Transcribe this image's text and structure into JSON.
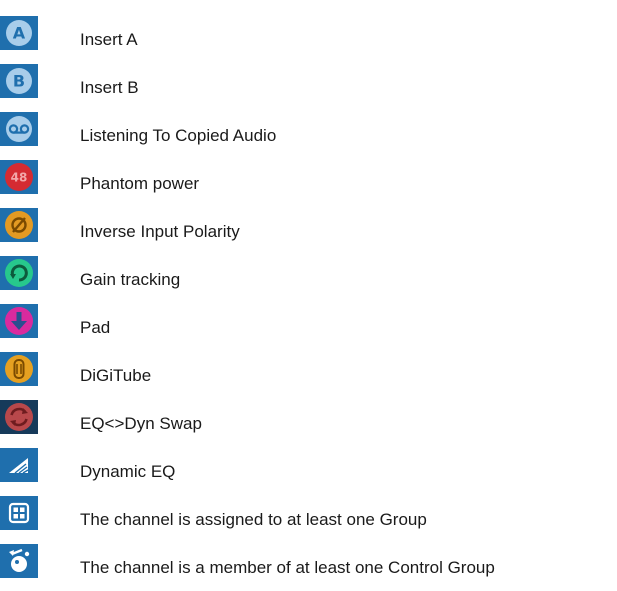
{
  "colors": {
    "tile_blue": "#1f6fad",
    "tile_dark": "#163a5a",
    "pale_blue": "#a8cdea",
    "phantom_red": "#d42b32",
    "polarity_orange": "#e39a23",
    "gain_green": "#27c88c",
    "pad_magenta": "#d92a9e",
    "digitube_orange": "#e5a021",
    "swap_red": "#b8484b"
  },
  "items": [
    {
      "label": "Insert A",
      "icon": "insert-a-icon",
      "glyph": "A"
    },
    {
      "label": "Insert B",
      "icon": "insert-b-icon",
      "glyph": "B"
    },
    {
      "label": "Listening To Copied Audio",
      "icon": "tape-icon"
    },
    {
      "label": "Phantom power",
      "icon": "phantom-48v-icon",
      "glyph": "48"
    },
    {
      "label": "Inverse Input Polarity",
      "icon": "polarity-icon"
    },
    {
      "label": "Gain tracking",
      "icon": "gain-tracking-icon"
    },
    {
      "label": "Pad",
      "icon": "pad-down-arrow-icon"
    },
    {
      "label": "DiGiTube",
      "icon": "digitube-icon"
    },
    {
      "label": "EQ<>Dyn Swap",
      "icon": "swap-icon"
    },
    {
      "label": "Dynamic EQ",
      "icon": "dynamic-eq-icon"
    },
    {
      "label": "The channel is assigned to at least one Group",
      "icon": "group-icon"
    },
    {
      "label": "The channel is a member of at least one Control Group",
      "icon": "control-group-icon"
    }
  ]
}
